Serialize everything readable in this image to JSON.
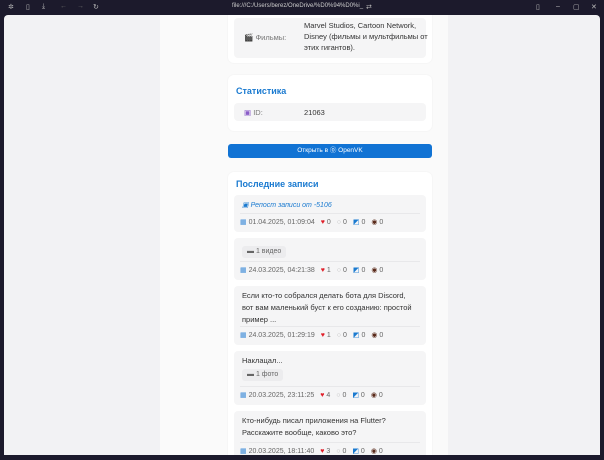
{
  "browser": {
    "url": "file:///C:/Users/berez/OneDrive/%D0%94%D0%i_"
  },
  "info": {
    "films_label": "Фильмы:",
    "films_value": "Marvel Studios, Cartoon Network, Disney (фильмы и мультфильмы от этих гигантов)."
  },
  "stats": {
    "title": "Статистика",
    "id_label": "ID:",
    "id_value": "21063"
  },
  "open_button": "Открыть в ⓪ OpenVK",
  "posts_title": "Последние записи",
  "posts": [
    {
      "repost": "Репост записи от -5106",
      "date": "01.04.2025, 01:09:04",
      "likes": "0",
      "comments": "0",
      "reposts": "0",
      "views": "0"
    },
    {
      "badge": "1 видео",
      "date": "24.03.2025, 04:21:38",
      "likes": "1",
      "comments": "0",
      "reposts": "0",
      "views": "0"
    },
    {
      "text": "Если кто-то собрался делать бота для Discord, вот вам маленький буст к его созданию: простой пример ...",
      "date": "24.03.2025, 01:29:19",
      "likes": "1",
      "comments": "0",
      "reposts": "0",
      "views": "0"
    },
    {
      "text": "Наклацал...",
      "badge": "1 фото",
      "date": "20.03.2025, 23:11:25",
      "likes": "4",
      "comments": "0",
      "reposts": "0",
      "views": "0"
    },
    {
      "text": "Кто-нибудь писал приложения на Flutter? Расскажите вообще, каково это?",
      "date": "20.03.2025, 18:11:40",
      "likes": "3",
      "comments": "0",
      "reposts": "0",
      "views": "0"
    }
  ]
}
